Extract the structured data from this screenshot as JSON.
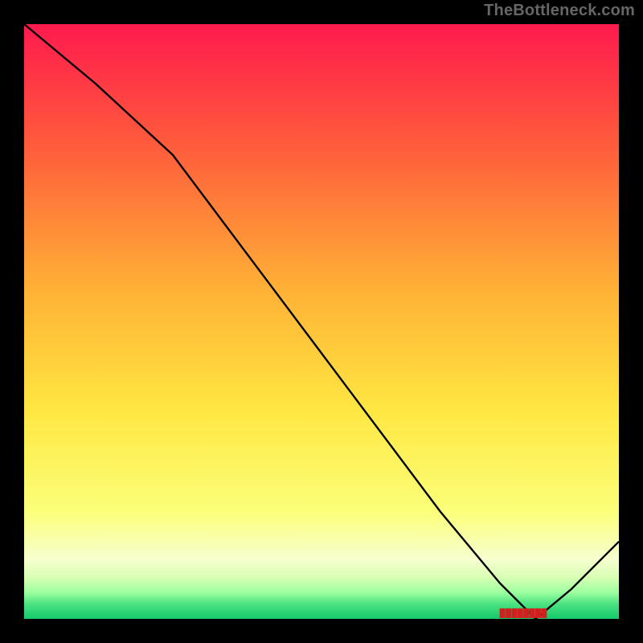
{
  "attribution": "TheBottleneck.com",
  "chart_data": {
    "type": "line",
    "title": "",
    "xlabel": "",
    "ylabel": "",
    "xlim": [
      0,
      100
    ],
    "ylim": [
      0,
      100
    ],
    "grid": false,
    "legend": false,
    "gradient_stops": [
      {
        "offset": 0,
        "color": "#ff1a4e"
      },
      {
        "offset": 0.2,
        "color": "#ff5a3c"
      },
      {
        "offset": 0.45,
        "color": "#ffb236"
      },
      {
        "offset": 0.65,
        "color": "#ffe742"
      },
      {
        "offset": 0.82,
        "color": "#fbff7a"
      },
      {
        "offset": 0.9,
        "color": "#f7ffcf"
      },
      {
        "offset": 0.93,
        "color": "#d8ffb4"
      },
      {
        "offset": 0.955,
        "color": "#9fffa0"
      },
      {
        "offset": 0.975,
        "color": "#4be281"
      },
      {
        "offset": 1.0,
        "color": "#13c96b"
      }
    ],
    "series": [
      {
        "name": "bottleneck-curve",
        "color": "#000000",
        "x": [
          0,
          12,
          25,
          40,
          55,
          70,
          80,
          86,
          92,
          100
        ],
        "y": [
          100,
          90,
          78,
          58,
          38,
          18,
          6,
          0,
          5,
          13
        ]
      }
    ],
    "annotations": [
      {
        "id": "min-marker",
        "x": 84,
        "y": 0.5,
        "text": "████████"
      }
    ]
  }
}
